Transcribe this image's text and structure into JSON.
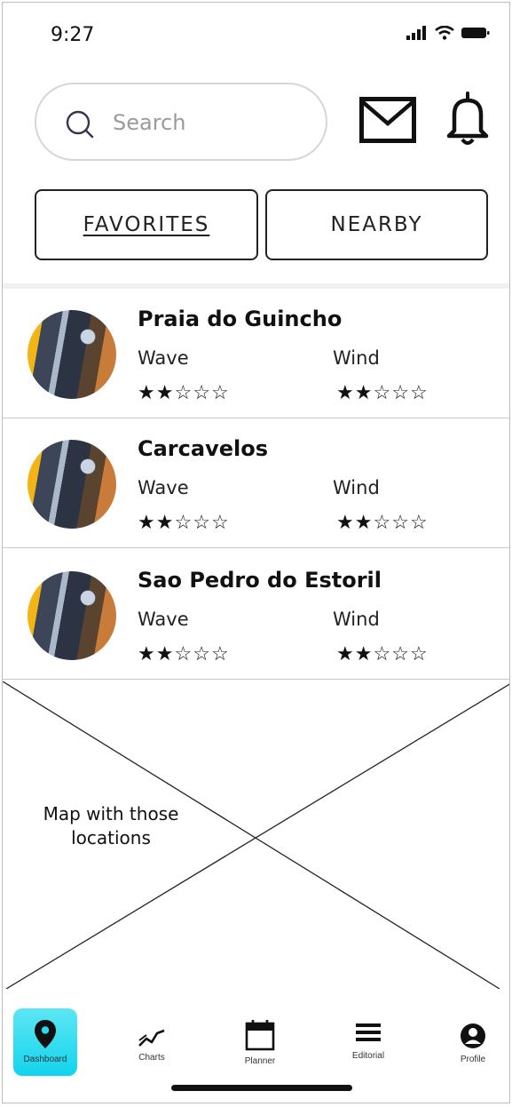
{
  "status_bar": {
    "time": "9:27"
  },
  "search": {
    "placeholder": "Search"
  },
  "tabs": [
    {
      "label": "FAVORITES",
      "active": true
    },
    {
      "label": "NEARBY",
      "active": false
    }
  ],
  "spots": [
    {
      "name": "Praia do Guincho",
      "wave_label": "Wave",
      "wind_label": "Wind",
      "wave_rating": 2,
      "wind_rating": 2,
      "max_rating": 5
    },
    {
      "name": "Carcavelos",
      "wave_label": "Wave",
      "wind_label": "Wind",
      "wave_rating": 2,
      "wind_rating": 2,
      "max_rating": 5
    },
    {
      "name": "Sao Pedro do Estoril",
      "wave_label": "Wave",
      "wind_label": "Wind",
      "wave_rating": 2,
      "wind_rating": 2,
      "max_rating": 5
    }
  ],
  "map": {
    "placeholder_line1": "Map with those",
    "placeholder_line2": "locations"
  },
  "nav": [
    {
      "label": "Dashboard",
      "icon": "location-pin-icon",
      "active": true
    },
    {
      "label": "Charts",
      "icon": "chart-line-icon",
      "active": false
    },
    {
      "label": "Planner",
      "icon": "calendar-icon",
      "active": false
    },
    {
      "label": "Editorial",
      "icon": "list-icon",
      "active": false
    },
    {
      "label": "Profile",
      "icon": "user-icon",
      "active": false
    }
  ],
  "colors": {
    "nav_active": "#12d4ee",
    "border": "#222222",
    "divider": "#c9c9c9"
  }
}
